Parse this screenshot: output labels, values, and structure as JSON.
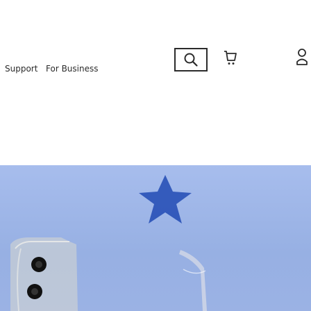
{
  "nav": {
    "support_label": "Support",
    "business_label": "For Business"
  },
  "icons": {
    "search": "search-icon",
    "cart": "cart-icon",
    "account": "account-icon"
  },
  "colors": {
    "hero_background": "#9cb4e5",
    "star": "#2a53b7",
    "text": "#2b2b2b"
  }
}
